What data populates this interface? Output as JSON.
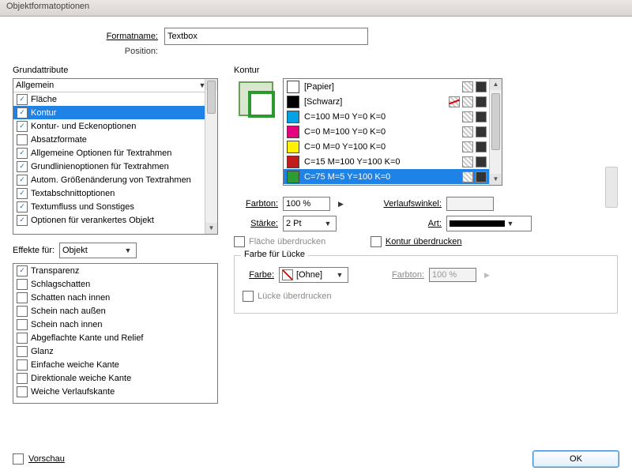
{
  "window": {
    "title": "Objektformatoptionen"
  },
  "header": {
    "formatname_label": "Formatname:",
    "formatname_value": "Textbox",
    "position_label": "Position:"
  },
  "left": {
    "grund_title": "Grundattribute",
    "dropdown": "Allgemein",
    "items": [
      {
        "label": "Fläche",
        "checked": true
      },
      {
        "label": "Kontur",
        "checked": true,
        "selected": true
      },
      {
        "label": "Kontur- und Eckenoptionen",
        "checked": true
      },
      {
        "label": "Absatzformate",
        "checked": false
      },
      {
        "label": "Allgemeine Optionen für Textrahmen",
        "checked": true
      },
      {
        "label": "Grundlinienoptionen für Textrahmen",
        "checked": true
      },
      {
        "label": "Autom. Größenänderung von Textrahmen",
        "checked": true
      },
      {
        "label": "Textabschnittoptionen",
        "checked": true
      },
      {
        "label": "Textumfluss und Sonstiges",
        "checked": true
      },
      {
        "label": "Optionen für verankertes Objekt",
        "checked": true
      }
    ],
    "effects_label": "Effekte für:",
    "effects_target": "Objekt",
    "fx": [
      {
        "label": "Transparenz",
        "checked": true
      },
      {
        "label": "Schlagschatten",
        "checked": false
      },
      {
        "label": "Schatten nach innen",
        "checked": false
      },
      {
        "label": "Schein nach außen",
        "checked": false
      },
      {
        "label": "Schein nach innen",
        "checked": false
      },
      {
        "label": "Abgeflachte Kante und Relief",
        "checked": false
      },
      {
        "label": "Glanz",
        "checked": false
      },
      {
        "label": "Einfache weiche Kante",
        "checked": false
      },
      {
        "label": "Direktionale weiche Kante",
        "checked": false
      },
      {
        "label": "Weiche Verlaufskante",
        "checked": false
      }
    ]
  },
  "right": {
    "kontur_title": "Kontur",
    "swatches": [
      {
        "name": "[Papier]",
        "color": "#ffffff",
        "pencil": false
      },
      {
        "name": "[Schwarz]",
        "color": "#000000",
        "pencil": true
      },
      {
        "name": "C=100 M=0 Y=0 K=0",
        "color": "#00a4e4"
      },
      {
        "name": "C=0 M=100 Y=0 K=0",
        "color": "#e5007e"
      },
      {
        "name": "C=0 M=0 Y=100 K=0",
        "color": "#fff200"
      },
      {
        "name": "C=15 M=100 Y=100 K=0",
        "color": "#c21b1e"
      },
      {
        "name": "C=75 M=5 Y=100 K=0",
        "color": "#2d9b33",
        "selected": true
      }
    ],
    "farbton_label": "Farbton:",
    "farbton_value": "100 %",
    "verlaufswinkel_label": "Verlaufswinkel:",
    "staerke_label": "Stärke:",
    "staerke_value": "2 Pt",
    "art_label": "Art:",
    "flaeche_ueberdrucken": "Fläche überdrucken",
    "kontur_ueberdrucken": "Kontur überdrucken",
    "gap_title": "Farbe für Lücke",
    "gap_farbe_label": "Farbe:",
    "gap_farbe_value": "[Ohne]",
    "gap_farbton_label": "Farbton:",
    "gap_farbton_value": "100 %",
    "gap_ueberdrucken": "Lücke überdrucken"
  },
  "footer": {
    "vorschau": "Vorschau",
    "ok": "OK"
  }
}
